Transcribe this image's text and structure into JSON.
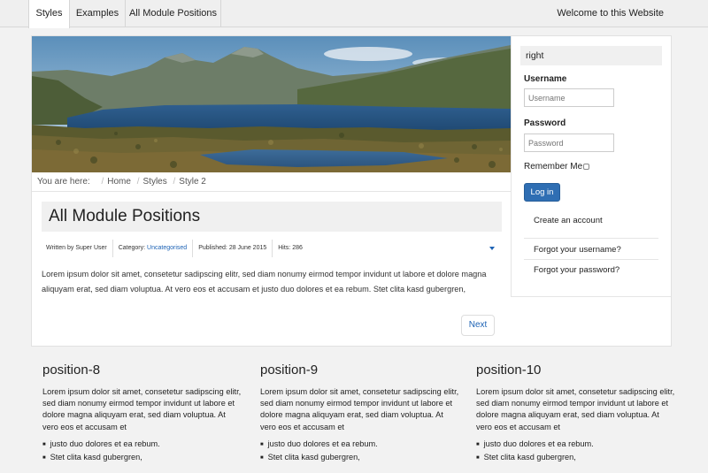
{
  "nav": {
    "tabs": [
      {
        "label": "Styles",
        "active": true
      },
      {
        "label": "Examples",
        "active": false
      },
      {
        "label": "All Module Positions",
        "active": false
      }
    ],
    "welcome": "Welcome to this Website"
  },
  "breadcrumb": {
    "prefix": "You are here:",
    "items": [
      "Home",
      "Styles",
      "Style 2"
    ]
  },
  "article": {
    "title": "All Module Positions",
    "meta": {
      "written_by": "Written by Super User",
      "category_label": "Category:",
      "category_value": "Uncategorised",
      "published": "Published: 28 June 2015",
      "hits": "Hits: 286"
    },
    "body": "Lorem ipsum dolor sit amet, consetetur sadipscing elitr, sed diam nonumy eirmod tempor invidunt ut labore et dolore magna aliquyam erat, sed diam voluptua. At vero eos et accusam et justo duo dolores et ea rebum. Stet clita kasd gubergren,",
    "next_label": "Next"
  },
  "sidebar": {
    "heading": "right",
    "username_label": "Username",
    "username_placeholder": "Username",
    "password_label": "Password",
    "password_placeholder": "Password",
    "remember_label": "Remember Me",
    "login_label": "Log in",
    "links": [
      "Create an account",
      "Forgot your username?",
      "Forgot your password?"
    ]
  },
  "positions": [
    {
      "title": "position-8",
      "text": "Lorem ipsum dolor sit amet, consetetur sadipscing elitr, sed diam nonumy eirmod tempor invidunt ut labore et dolore magna aliquyam erat, sed diam voluptua. At vero eos et accusam et",
      "items": [
        "justo duo dolores et ea rebum.",
        "Stet clita kasd gubergren,"
      ]
    },
    {
      "title": "position-9",
      "text": "Lorem ipsum dolor sit amet, consetetur sadipscing elitr, sed diam nonumy eirmod tempor invidunt ut labore et dolore magna aliquyam erat, sed diam voluptua. At vero eos et accusam et",
      "items": [
        "justo duo dolores et ea rebum.",
        "Stet clita kasd gubergren,"
      ]
    },
    {
      "title": "position-10",
      "text": "Lorem ipsum dolor sit amet, consetetur sadipscing elitr, sed diam nonumy eirmod tempor invidunt ut labore et dolore magna aliquyam erat, sed diam voluptua. At vero eos et accusam et",
      "items": [
        "justo duo dolores et ea rebum.",
        "Stet clita kasd gubergren,"
      ]
    }
  ],
  "colors": {
    "link": "#1e63b5",
    "button": "#2f6eb3",
    "page_bg": "#f2f2f2"
  }
}
